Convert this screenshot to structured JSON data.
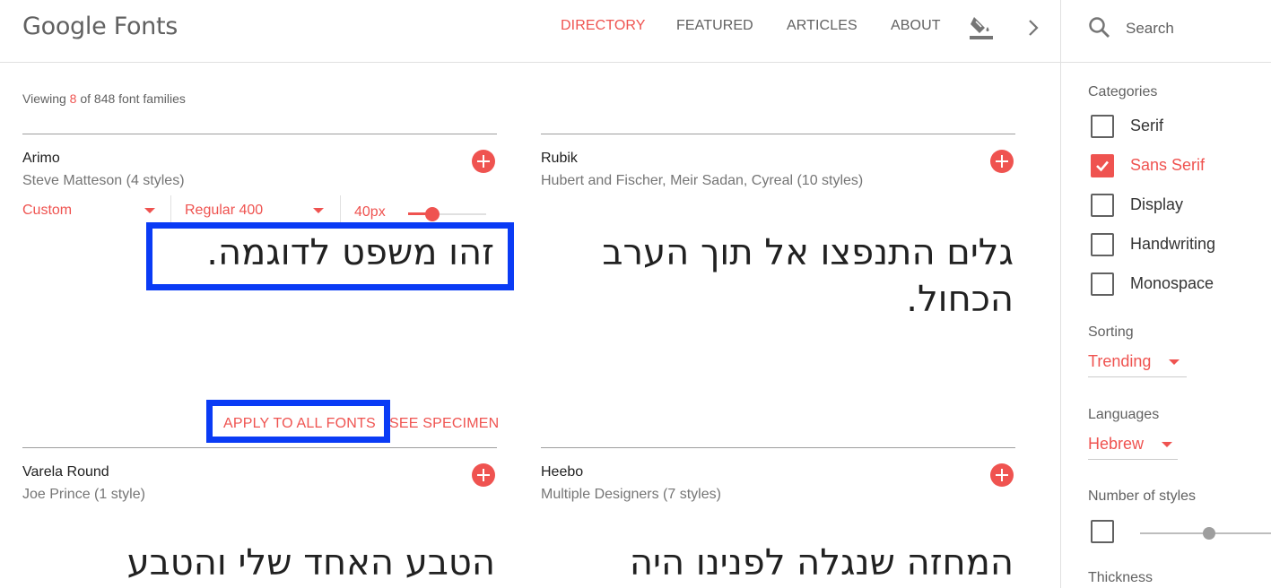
{
  "header": {
    "logo": "Google Fonts",
    "nav": [
      "DIRECTORY",
      "FEATURED",
      "ARTICLES",
      "ABOUT"
    ],
    "active_nav": "DIRECTORY"
  },
  "search": {
    "placeholder": "Search"
  },
  "viewing": {
    "prefix": "Viewing ",
    "count": "8",
    "suffix": " of 848 font families"
  },
  "cards": [
    {
      "name": "Arimo",
      "meta": "Steve Matteson (4 styles)",
      "sample": "זהו משפט לדוגמה.",
      "controls": {
        "text": "Custom",
        "style": "Regular 400",
        "size": "40px",
        "size_level": 0.35
      },
      "actions": {
        "apply": "APPLY TO ALL FONTS",
        "specimen": "SEE SPECIMEN"
      }
    },
    {
      "name": "Rubik",
      "meta": "Hubert and Fischer, Meir Sadan, Cyreal (10 styles)",
      "sample": "גלים התנפצו אל תוך הערב הכחול."
    },
    {
      "name": "Varela Round",
      "meta": "Joe Prince (1 style)",
      "sample": "הטבע האחד שלי והטבע"
    },
    {
      "name": "Heebo",
      "meta": "Multiple Designers (7 styles)",
      "sample": "המחזה שנגלה לפנינו היה"
    }
  ],
  "sidebar": {
    "categories_heading": "Categories",
    "categories": [
      {
        "label": "Serif",
        "checked": false
      },
      {
        "label": "Sans Serif",
        "checked": true
      },
      {
        "label": "Display",
        "checked": false
      },
      {
        "label": "Handwriting",
        "checked": false
      },
      {
        "label": "Monospace",
        "checked": false
      }
    ],
    "sorting_heading": "Sorting",
    "sorting_value": "Trending",
    "languages_heading": "Languages",
    "languages_value": "Hebrew",
    "styles_heading": "Number of styles",
    "thickness_heading": "Thickness"
  },
  "colors": {
    "accent": "#ef5350",
    "highlight": "#0a3bf5",
    "muted": "#616161"
  }
}
